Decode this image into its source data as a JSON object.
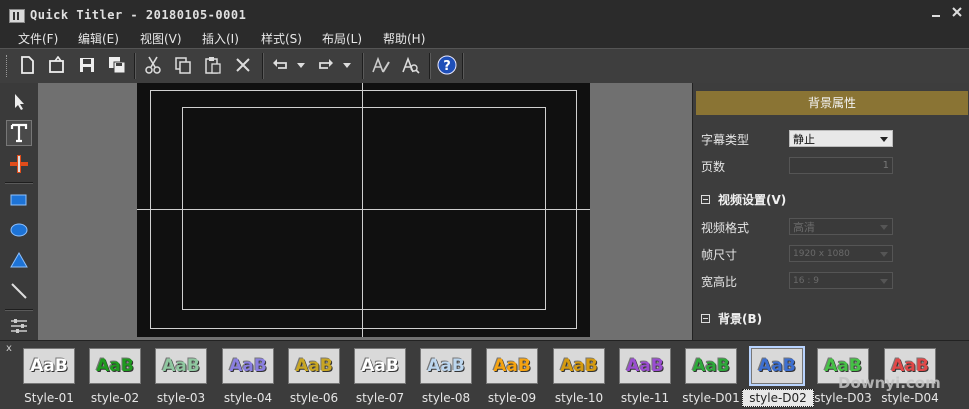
{
  "window": {
    "title": "Quick Titler - 20180105-0001"
  },
  "menu": [
    "文件(F)",
    "编辑(E)",
    "视图(V)",
    "插入(I)",
    "样式(S)",
    "布局(L)",
    "帮助(H)"
  ],
  "toolbar": {
    "icons": [
      "new-icon",
      "open-icon",
      "save-icon",
      "save-all-icon",
      "cut-icon",
      "copy-icon",
      "paste-icon",
      "delete-icon",
      "undo-icon",
      "undo-dropdown-icon",
      "redo-icon",
      "redo-dropdown-icon",
      "text-style-icon",
      "font-icon",
      "help-icon"
    ]
  },
  "tools": [
    "select-arrow-icon",
    "text-tool-icon",
    "move-tool-icon",
    "rectangle-tool-icon",
    "ellipse-tool-icon",
    "triangle-tool-icon",
    "line-tool-icon",
    "settings-tool-icon"
  ],
  "panel": {
    "header": "背景属性",
    "rows": {
      "caption_type": {
        "label": "字幕类型",
        "value": "静止"
      },
      "page_count": {
        "label": "页数",
        "value": "1"
      }
    },
    "video_section": "视频设置(V)",
    "video": {
      "format": {
        "label": "视频格式",
        "value": "高清"
      },
      "frame": {
        "label": "帧尺寸",
        "value": "1920 x 1080"
      },
      "aspect": {
        "label": "宽高比",
        "value": "16 : 9"
      }
    },
    "background_section": "背景(B)"
  },
  "styles": {
    "close": "x",
    "items": [
      {
        "label": "Style-01",
        "color": "#ffffff",
        "text": "AaB"
      },
      {
        "label": "style-02",
        "color": "#1f9a1f",
        "text": "AaB"
      },
      {
        "label": "style-03",
        "color": "#8fc7a0",
        "text": "AaB"
      },
      {
        "label": "style-04",
        "color": "#8a7fe0",
        "text": "AaB"
      },
      {
        "label": "style-06",
        "color": "#c8a624",
        "text": "AaB"
      },
      {
        "label": "style-07",
        "color": "#ffffff",
        "text": "AaB"
      },
      {
        "label": "style-08",
        "color": "#bcd6ee",
        "text": "AaB"
      },
      {
        "label": "style-09",
        "color": "#f5a311",
        "text": "AaB"
      },
      {
        "label": "style-10",
        "color": "#d49a10",
        "text": "AaB"
      },
      {
        "label": "style-11",
        "color": "#9a4ed0",
        "text": "AaB"
      },
      {
        "label": "style-D01",
        "color": "#2ea83a",
        "text": "AaB"
      },
      {
        "label": "style-D02",
        "color": "#3d6fd0",
        "text": "AaB",
        "selected": true
      },
      {
        "label": "style-D03",
        "color": "#46c046",
        "text": "AaB"
      },
      {
        "label": "style-D04",
        "color": "#e04848",
        "text": "AaB"
      }
    ]
  },
  "watermark": "Downyi.com"
}
